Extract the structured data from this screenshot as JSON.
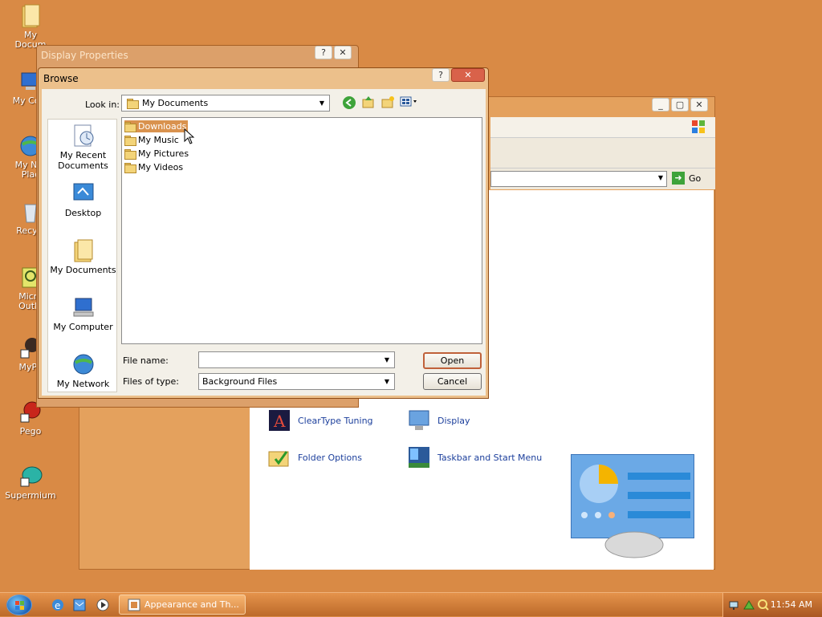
{
  "desktop": {
    "icons": [
      {
        "label": "My\nDocum",
        "kind": "folder"
      },
      {
        "label": "My Com",
        "kind": "computer"
      },
      {
        "label": "My Net\nPlac",
        "kind": "network"
      },
      {
        "label": "Recycl",
        "kind": "recycle"
      },
      {
        "label": "Micro\nOutlo",
        "kind": "outlook"
      },
      {
        "label": "MyPa",
        "kind": "shortcut"
      },
      {
        "label": "Pego",
        "kind": "pego"
      },
      {
        "label": "Supermium",
        "kind": "supermium"
      }
    ]
  },
  "background_window": {
    "go_label": "Go",
    "tasks": [
      {
        "label": "ClearType Tuning",
        "icon": "cleartype-icon"
      },
      {
        "label": "Display",
        "icon": "display-icon"
      },
      {
        "label": "Folder Options",
        "icon": "folder-options-icon"
      },
      {
        "label": "Taskbar and Start Menu",
        "icon": "taskbar-icon"
      }
    ]
  },
  "display_properties": {
    "title": "Display Properties"
  },
  "browse_dialog": {
    "title": "Browse",
    "look_in_label": "Look in:",
    "look_in_value": "My Documents",
    "places": [
      {
        "label": "My Recent\nDocuments",
        "icon": "recent-documents-icon"
      },
      {
        "label": "Desktop",
        "icon": "desktop-icon"
      },
      {
        "label": "My Documents",
        "icon": "my-documents-icon"
      },
      {
        "label": "My Computer",
        "icon": "my-computer-icon"
      },
      {
        "label": "My Network",
        "icon": "my-network-icon"
      }
    ],
    "files": [
      {
        "name": "Downloads",
        "selected": true
      },
      {
        "name": "My Music",
        "selected": false
      },
      {
        "name": "My Pictures",
        "selected": false
      },
      {
        "name": "My Videos",
        "selected": false
      }
    ],
    "file_name_label": "File name:",
    "file_name_value": "",
    "files_of_type_label": "Files of type:",
    "files_of_type_value": "Background Files",
    "open_label": "Open",
    "cancel_label": "Cancel"
  },
  "taskbar": {
    "task_button_label": "Appearance and Th...",
    "clock": "11:54 AM"
  },
  "colors": {
    "desktop": "#d98a45",
    "selection": "#d9924e",
    "link": "#1c3f9c"
  }
}
